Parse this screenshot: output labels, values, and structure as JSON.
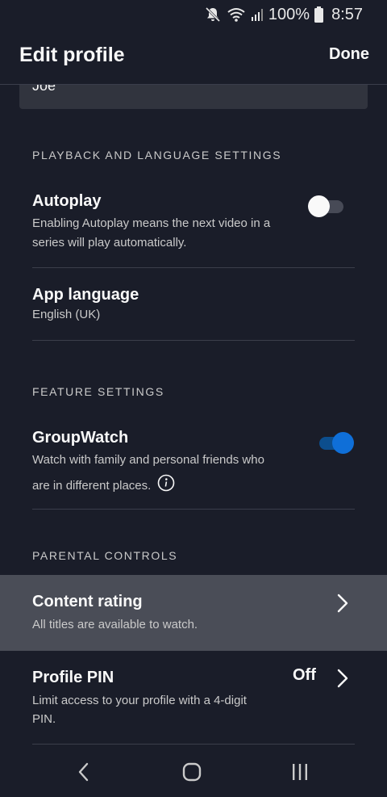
{
  "status_bar": {
    "battery": "100%",
    "time": "8:57",
    "icons": [
      "mute-icon",
      "wifi-icon",
      "signal-icon",
      "battery-icon"
    ]
  },
  "header": {
    "title": "Edit profile",
    "done_label": "Done"
  },
  "name_field": {
    "value": "Joe"
  },
  "playback": {
    "section_title": "PLAYBACK AND LANGUAGE SETTINGS",
    "autoplay": {
      "title": "Autoplay",
      "desc_line1": "Enabling Autoplay means the next video in a",
      "desc_line2": "series will play automatically.",
      "enabled": false
    },
    "app_language": {
      "title": "App language",
      "value": "English (UK)"
    }
  },
  "features": {
    "section_title": "FEATURE SETTINGS",
    "groupwatch": {
      "title": "GroupWatch",
      "desc_line1": "Watch with family and personal friends who",
      "desc_line2": "are in different places.",
      "enabled": true,
      "info_icon": "info-icon"
    }
  },
  "parental": {
    "section_title": "PARENTAL CONTROLS",
    "content_rating": {
      "title": "Content rating",
      "desc": "All titles are available to watch."
    },
    "profile_pin": {
      "title": "Profile PIN",
      "status": "Off",
      "desc_line1": "Limit access to your profile with a 4-digit",
      "desc_line2": "PIN."
    }
  },
  "nav_bar": {
    "icons": [
      "back-icon",
      "home-icon",
      "recents-icon"
    ]
  },
  "colors": {
    "background": "#1a1d29",
    "highlight": "#4a4d57",
    "toggle_on": "#0f6fd8",
    "text_primary": "#f9f9f9",
    "text_secondary": "#cacaca"
  }
}
